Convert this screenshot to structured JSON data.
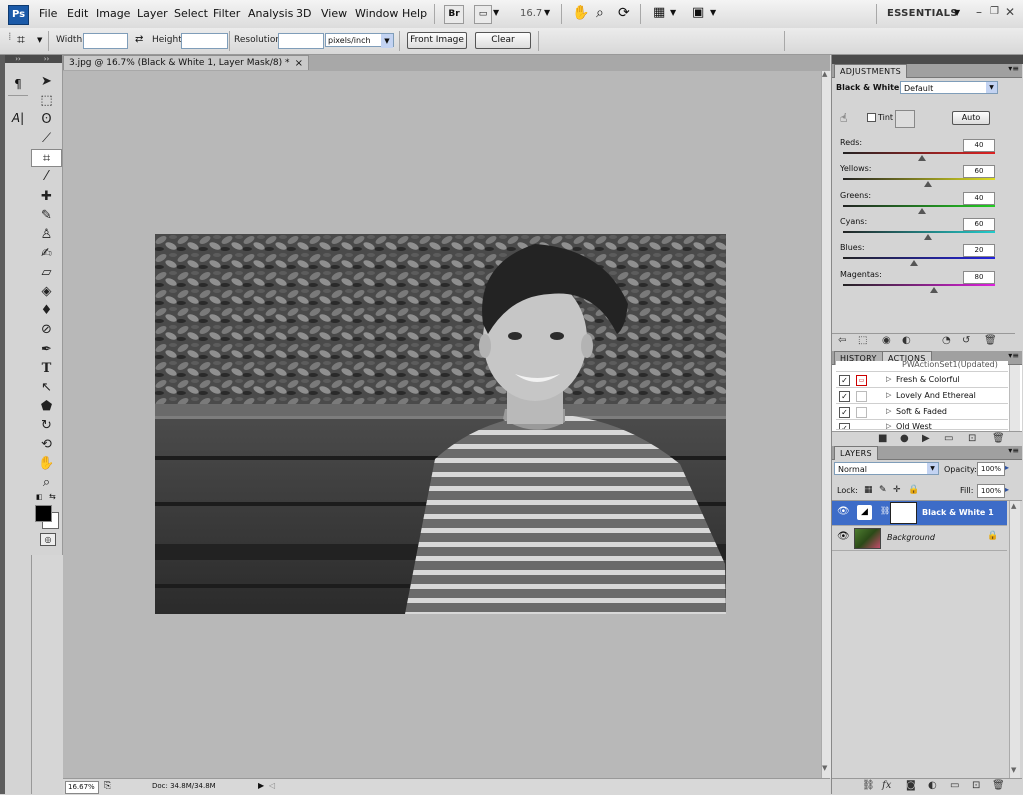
{
  "app": {
    "logo_text": "Ps",
    "brand_color": "#1b5aa8"
  },
  "menu": {
    "items": [
      "File",
      "Edit",
      "Image",
      "Layer",
      "Select",
      "Filter",
      "Analysis",
      "3D",
      "View",
      "Window",
      "Help"
    ],
    "bridge_label": "Br",
    "zoom_value": "16.7",
    "workspace": "ESSENTIALS"
  },
  "options_bar": {
    "width_label": "Width:",
    "height_label": "Height:",
    "resolution_label": "Resolution:",
    "unit_value": "pixels/inch",
    "front_image_label": "Front Image",
    "clear_label": "Clear"
  },
  "document": {
    "tab_title": "3.jpg @ 16.7% (Black & White 1, Layer Mask/8) *",
    "close_glyph": "×",
    "status_zoom": "16.67%",
    "status_doc": "Doc: 34.8M/34.8M"
  },
  "adjustments": {
    "tab_label": "ADJUSTMENTS",
    "title": "Black & White",
    "preset_value": "Default",
    "tint_label": "Tint",
    "auto_label": "Auto",
    "sliders": [
      {
        "label": "Reds:",
        "value": "40",
        "fraction": 0.52
      },
      {
        "label": "Yellows:",
        "value": "60",
        "fraction": 0.56
      },
      {
        "label": "Greens:",
        "value": "40",
        "fraction": 0.52
      },
      {
        "label": "Cyans:",
        "value": "60",
        "fraction": 0.56
      },
      {
        "label": "Blues:",
        "value": "20",
        "fraction": 0.47
      },
      {
        "label": "Magentas:",
        "value": "80",
        "fraction": 0.6
      }
    ]
  },
  "history_actions": {
    "history_tab": "HISTORY",
    "actions_tab": "ACTIONS",
    "set_name": "PWActionSet1(Updated)",
    "actions": [
      "Fresh & Colorful",
      "Lovely And Ethereal",
      "Soft & Faded",
      "Old West"
    ]
  },
  "layers": {
    "tab_label": "LAYERS",
    "blend_mode": "Normal",
    "opacity_label": "Opacity:",
    "opacity_value": "100%",
    "lock_label": "Lock:",
    "fill_label": "Fill:",
    "fill_value": "100%",
    "items": [
      {
        "name": "Black & White 1",
        "selected": true
      },
      {
        "name": "Background",
        "selected": false
      }
    ]
  },
  "colors": {
    "selection_blue": "#3d6cc8",
    "panel_gray": "#d4d4d4"
  }
}
